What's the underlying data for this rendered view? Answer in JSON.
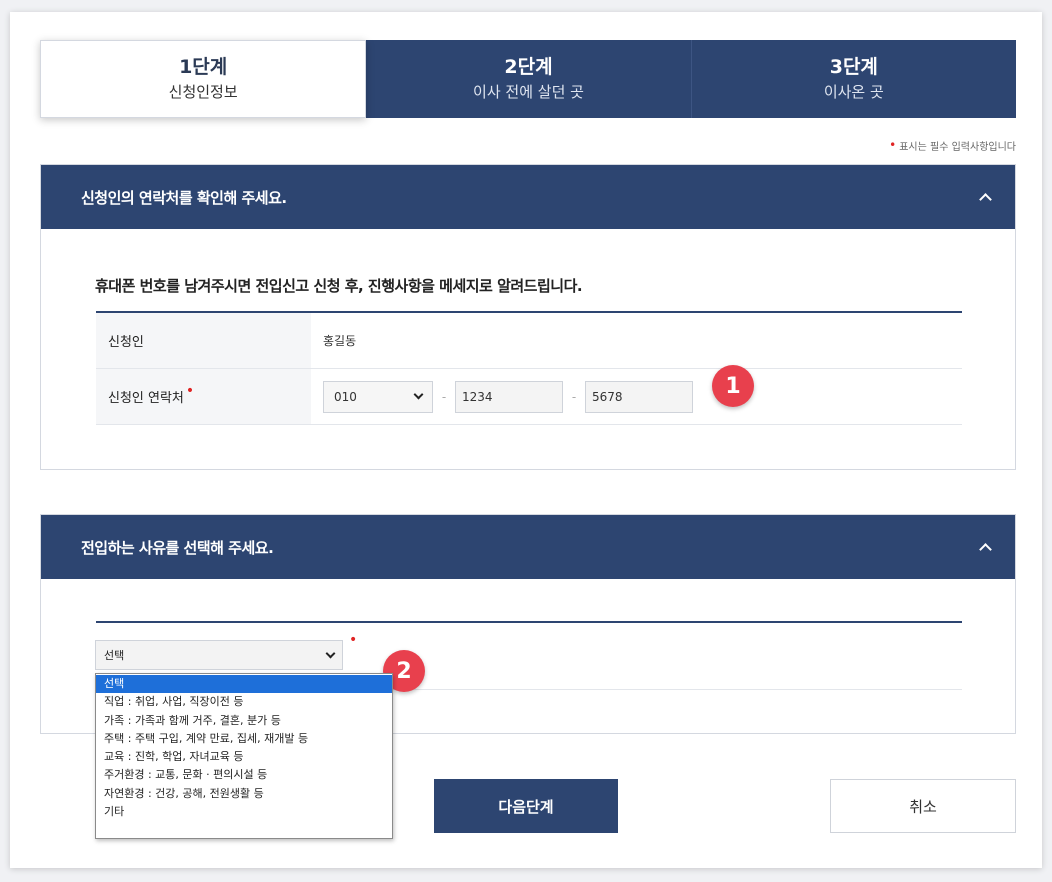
{
  "steps": [
    {
      "num": "1단계",
      "name": "신청인정보"
    },
    {
      "num": "2단계",
      "name": "이사 전에 살던 곳"
    },
    {
      "num": "3단계",
      "name": "이사온 곳"
    }
  ],
  "required_note": "표시는 필수 입력사항입니다",
  "section1": {
    "title": "신청인의 연락처를 확인해 주세요.",
    "intro": "휴대폰 번호를 남겨주시면 전입신고 신청 후, 진행사항을 메세지로 알려드립니다.",
    "applicant_label": "신청인",
    "applicant_name": "홍길동",
    "contact_label": "신청인 연락처",
    "phone": {
      "prefix": "010",
      "dash": "-",
      "middle": "1234",
      "last": "5678"
    }
  },
  "section2": {
    "title": "전입하는 사유를 선택해 주세요.",
    "selected": "선택",
    "options": [
      "선택",
      "직업 : 취업, 사업, 직장이전 등",
      "가족 : 가족과 함께 거주, 결혼, 분가 등",
      "주택 : 주택 구입, 계약 만료, 집세, 재개발 등",
      "교육 : 진학, 학업, 자녀교육 등",
      "주거환경 : 교통, 문화 · 편의시설 등",
      "자연환경 : 건강, 공해, 전원생활 등",
      "기타"
    ]
  },
  "badges": {
    "one": "1",
    "two": "2"
  },
  "buttons": {
    "next": "다음단계",
    "cancel": "취소"
  },
  "colors": {
    "navy": "#2d4571",
    "badge": "#e8404d",
    "required": "#e02424",
    "option_highlight": "#1e6fd9"
  },
  "icons": {
    "collapse": "chevron-up-icon",
    "select": "chevron-down-icon"
  }
}
